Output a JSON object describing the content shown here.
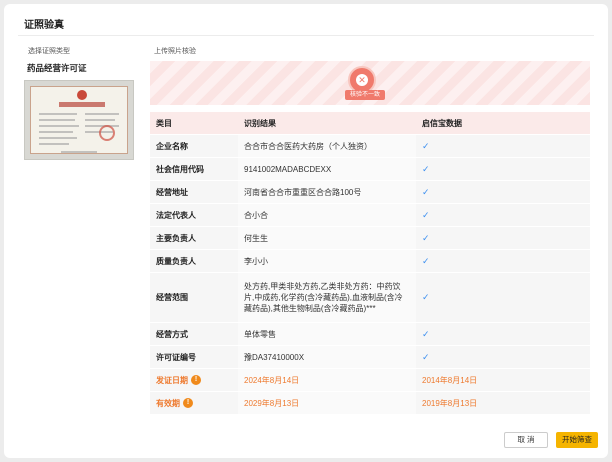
{
  "title": "证照验真",
  "labels": {
    "select_type": "选择证照类型",
    "upload_verify": "上传照片核验",
    "license_type": "药品经营许可证"
  },
  "banner": {
    "status_text": "核验不一致",
    "status_color": "#f07a6c"
  },
  "table": {
    "headers": [
      "类目",
      "识别结果",
      "启信宝数据"
    ],
    "rows": [
      {
        "key": "企业名称",
        "value": "合合市合合医药大药房（个人独资）",
        "check": "✓"
      },
      {
        "key": "社会信用代码",
        "value": "9141002MADABCDEXX",
        "check": "✓"
      },
      {
        "key": "经营地址",
        "value": "河南省合合市重重区合合路100号",
        "check": "✓"
      },
      {
        "key": "法定代表人",
        "value": "合小合",
        "check": "✓"
      },
      {
        "key": "主要负责人",
        "value": "何生生",
        "check": "✓"
      },
      {
        "key": "质量负责人",
        "value": "李小小",
        "check": "✓"
      },
      {
        "key": "经营范围",
        "value": "处方药,甲类非处方药,乙类非处方药：中药饮片,中成药,化学药(含冷藏药品),血液制品(含冷藏药品),其他生物制品(含冷藏药品)***",
        "check": "✓"
      },
      {
        "key": "经营方式",
        "value": "单体零售",
        "check": "✓"
      },
      {
        "key": "许可证编号",
        "value": "豫DA37410000X",
        "check": "✓"
      },
      {
        "key": "发证日期",
        "value": "2024年8月14日",
        "check": "2014年8月14日",
        "warn": "!"
      },
      {
        "key": "有效期",
        "value": "2029年8月13日",
        "check": "2019年8月13日",
        "warn": "!"
      }
    ]
  },
  "buttons": {
    "cancel": "取 消",
    "start": "开始筛查"
  },
  "colors": {
    "accent": "#f5b400",
    "check": "#3c8ff0",
    "warning": "#ee7a2f"
  }
}
